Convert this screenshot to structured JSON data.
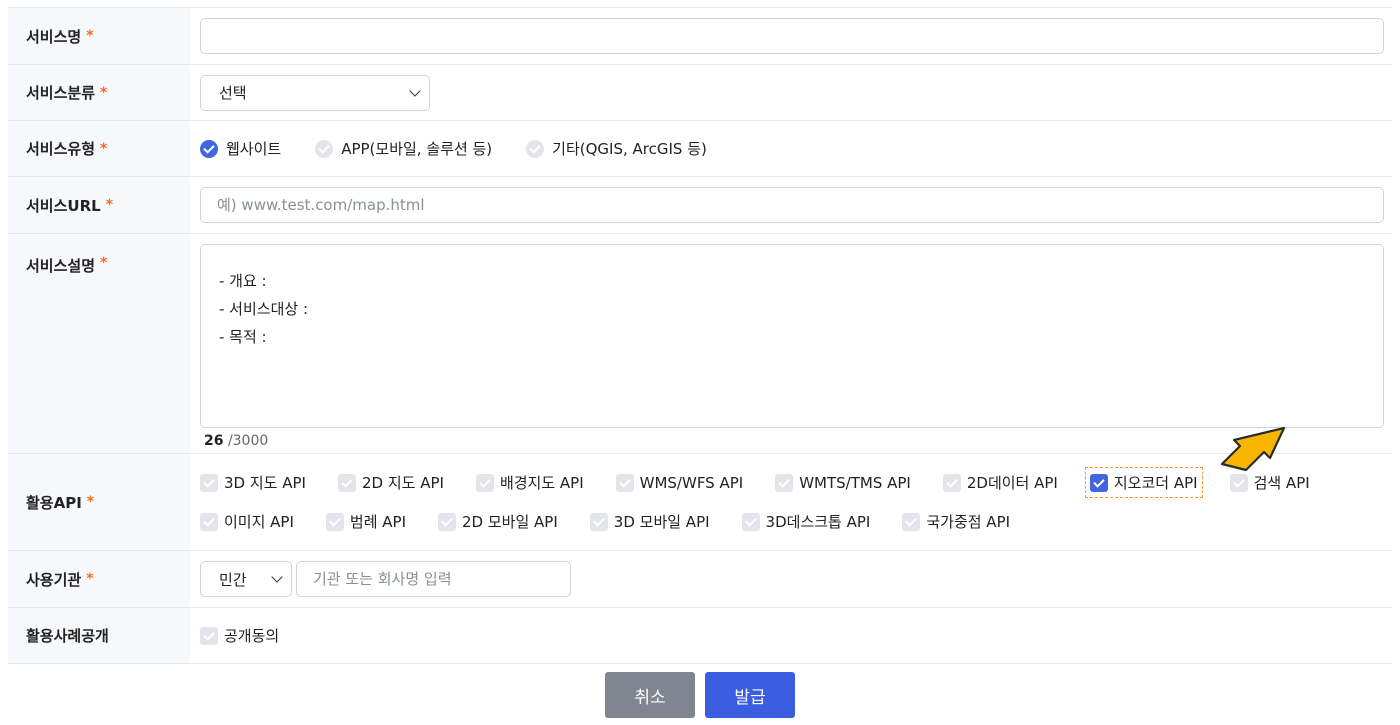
{
  "fields": {
    "service_name": {
      "label": "서비스명",
      "required": "*",
      "value": ""
    },
    "category": {
      "label": "서비스분류",
      "required": "*",
      "selected": "선택"
    },
    "service_type": {
      "label": "서비스유형",
      "required": "*",
      "options": [
        {
          "label": "웹사이트",
          "checked": true
        },
        {
          "label": "APP(모바일, 솔루션 등)",
          "checked": false
        },
        {
          "label": "기타(QGIS, ArcGIS 등)",
          "checked": false
        }
      ]
    },
    "service_url": {
      "label": "서비스URL",
      "required": "*",
      "placeholder": "예) www.test.com/map.html"
    },
    "description": {
      "label": "서비스설명",
      "required": "*",
      "lines": [
        "- 개요 :",
        "- 서비스대상 :",
        "- 목적 :"
      ],
      "count": "26",
      "max": "/3000"
    },
    "apis": {
      "label": "활용API",
      "required": "*",
      "row1": [
        {
          "label": "3D 지도 API",
          "checked": false
        },
        {
          "label": "2D 지도 API",
          "checked": false
        },
        {
          "label": "배경지도 API",
          "checked": false
        },
        {
          "label": "WMS/WFS API",
          "checked": false
        },
        {
          "label": "WMTS/TMS API",
          "checked": false
        },
        {
          "label": "2D데이터 API",
          "checked": false
        },
        {
          "label": "지오코더 API",
          "checked": true
        },
        {
          "label": "검색 API",
          "checked": false
        }
      ],
      "row2": [
        {
          "label": "이미지 API",
          "checked": false
        },
        {
          "label": "범례 API",
          "checked": false
        },
        {
          "label": "2D 모바일 API",
          "checked": false
        },
        {
          "label": "3D 모바일 API",
          "checked": false
        },
        {
          "label": "3D데스크톱 API",
          "checked": false
        },
        {
          "label": "국가중점 API",
          "checked": false
        }
      ]
    },
    "organization": {
      "label": "사용기관",
      "required": "*",
      "type_selected": "민간",
      "placeholder": "기관 또는 회사명 입력"
    },
    "public_case": {
      "label": "활용사례공개",
      "consent_label": "공개동의",
      "checked": false
    }
  },
  "buttons": {
    "cancel": "취소",
    "issue": "발급"
  },
  "colors": {
    "accent": "#3b5ee0",
    "required": "#f36b21",
    "pointer": "#f7b500"
  },
  "icons": {
    "pointer": "arrow-pointer-icon"
  }
}
